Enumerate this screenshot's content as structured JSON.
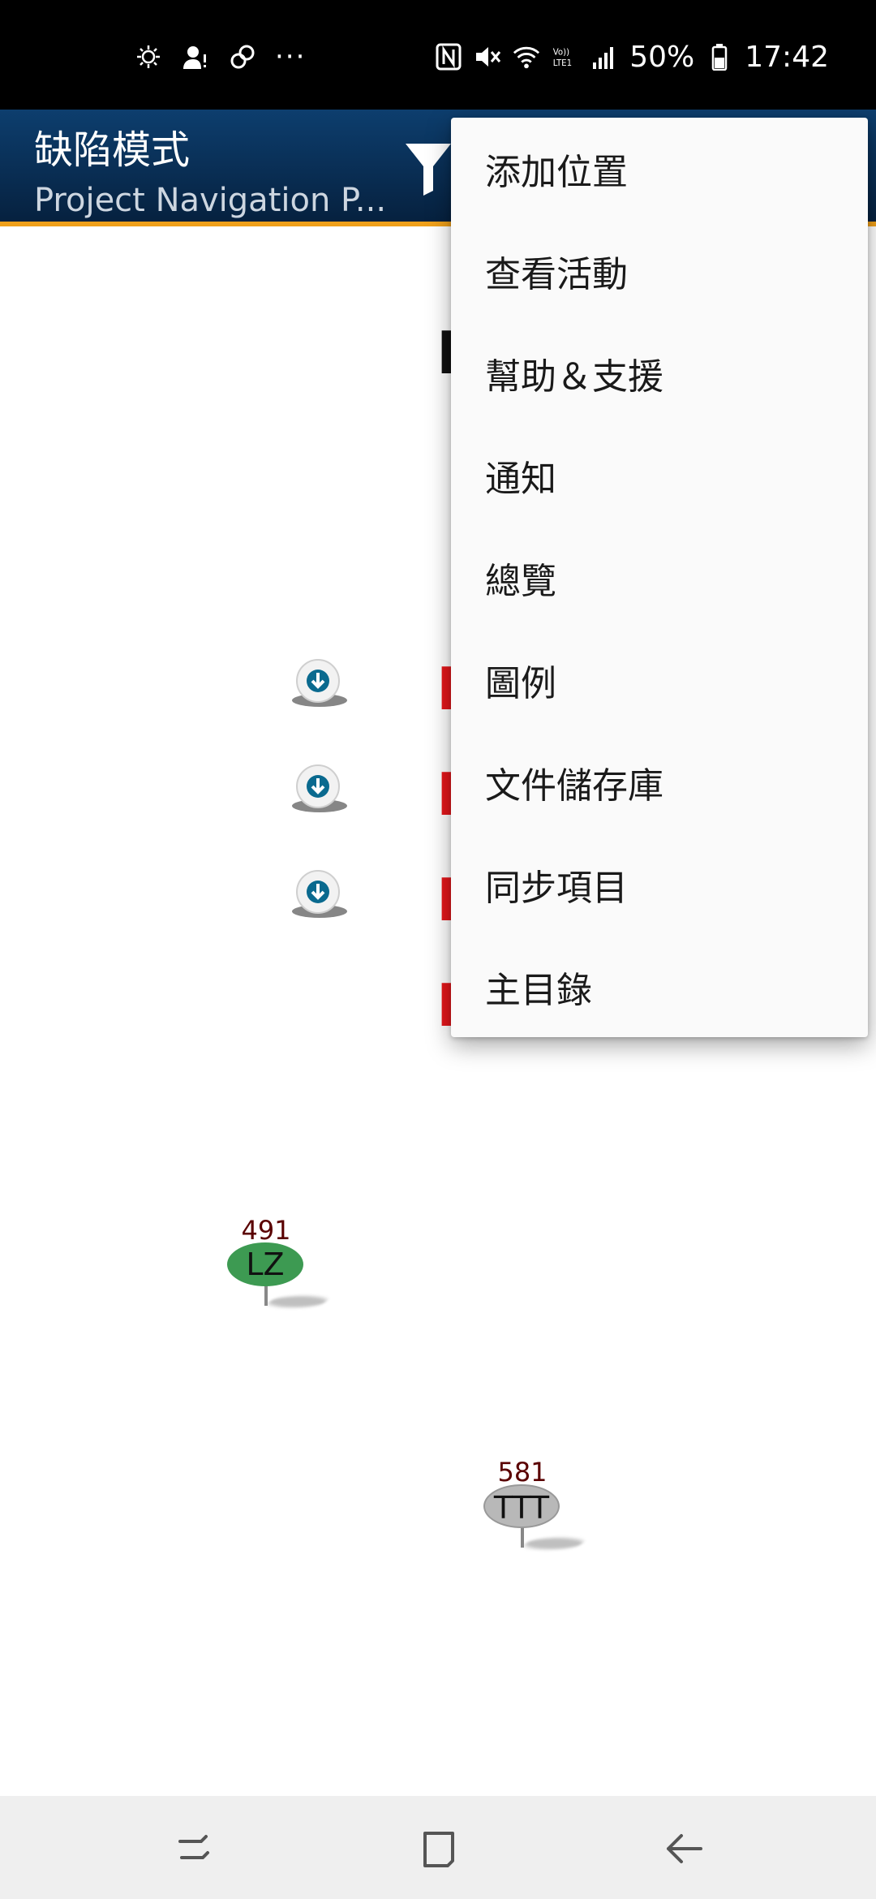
{
  "status_bar": {
    "left_icons": [
      "weather-icon",
      "user-alert-icon",
      "link-icon"
    ],
    "more": "···",
    "right_icons": [
      "nfc-icon",
      "mute-icon",
      "wifi-icon",
      "volte-icon",
      "signal-icon"
    ],
    "battery_text": "50%",
    "time": "17:42"
  },
  "app_bar": {
    "title": "缺陷模式",
    "subtitle": "Project Navigation P...",
    "filter_icon": "filter-icon"
  },
  "menu": {
    "items": [
      {
        "label": "添加位置"
      },
      {
        "label": "查看活動"
      },
      {
        "label": "幫助＆支援"
      },
      {
        "label": "通知"
      },
      {
        "label": "總覽"
      },
      {
        "label": "圖例"
      },
      {
        "label": "文件儲存庫"
      },
      {
        "label": "同步項目"
      },
      {
        "label": "主目錄"
      }
    ]
  },
  "map": {
    "pins": [
      {
        "number": "491",
        "label": "LZ",
        "color": "#3d9a52"
      },
      {
        "number": "581",
        "label": "TTT",
        "color": "#b8b8b8"
      }
    ],
    "download_icon": "download-icon",
    "peek_colors": {
      "black": "#111111",
      "red": "#e4161b"
    }
  },
  "nav_bar": {
    "icons": [
      "recent-apps-icon",
      "home-icon",
      "back-icon"
    ]
  }
}
